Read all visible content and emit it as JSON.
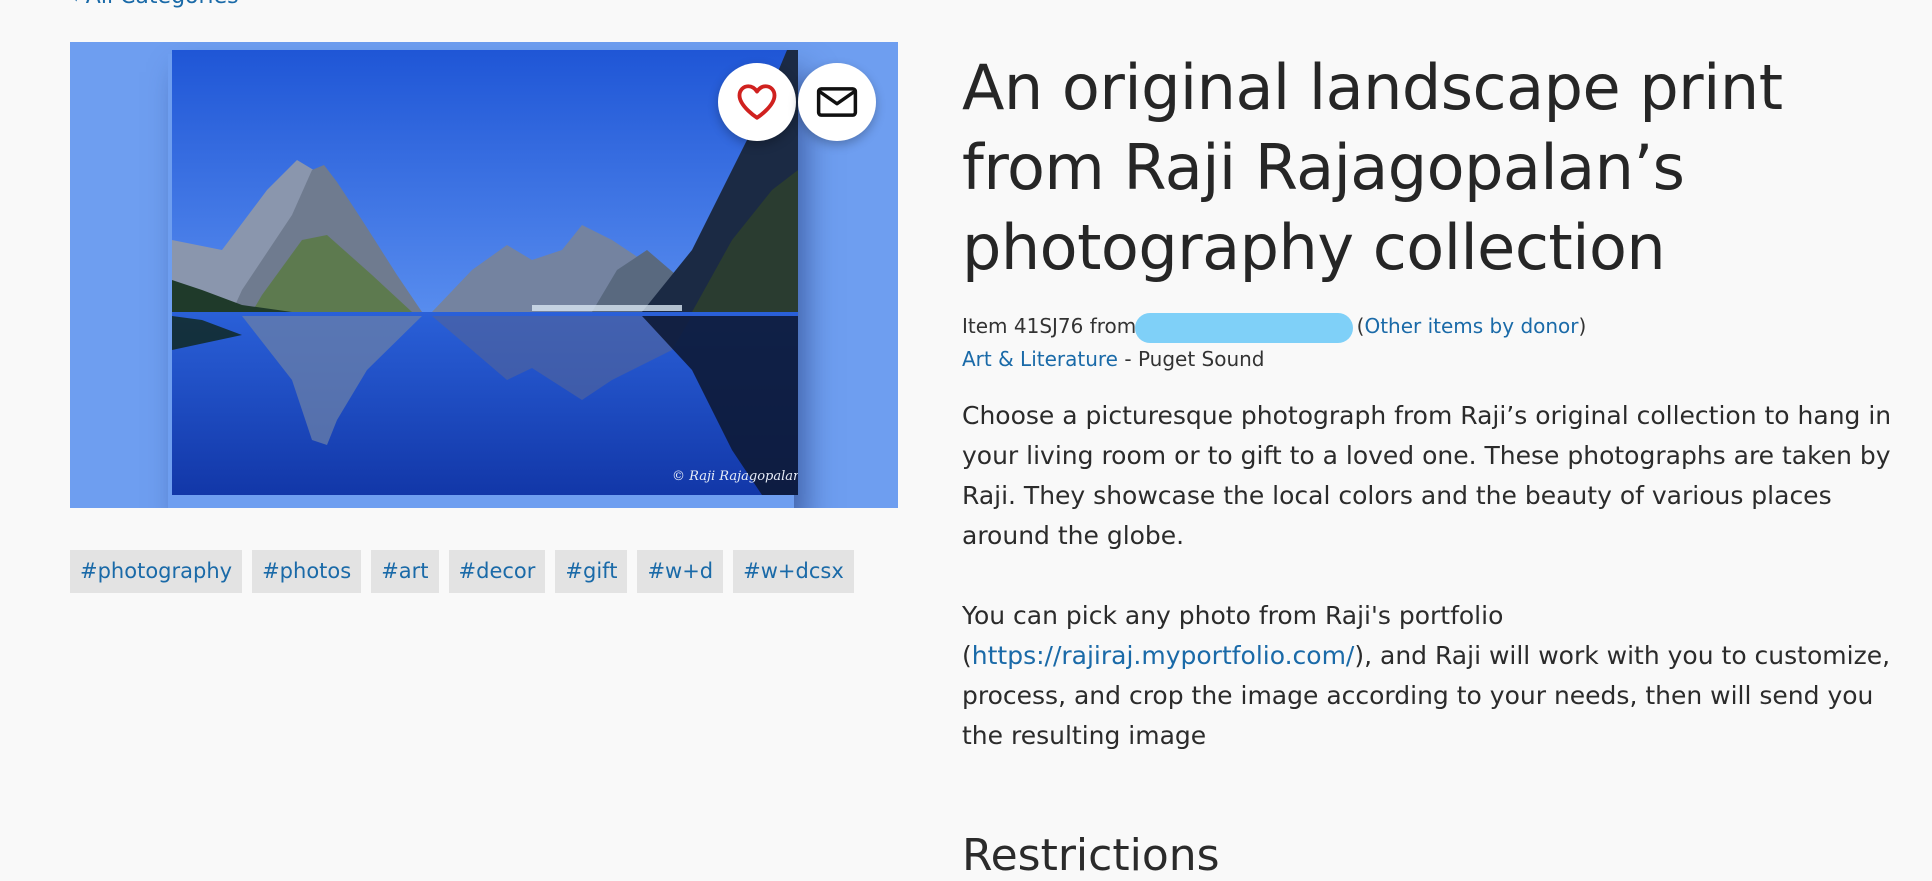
{
  "nav": {
    "back_label": "‹ All Categories"
  },
  "item": {
    "title": "An original landscape print from Raji Rajagopalan’s photography collection",
    "item_prefix": "Item 41SJ76 from",
    "other_items_label": "Other items by donor",
    "category_label": "Art & Literature",
    "category_separator": " - ",
    "location": "Puget Sound",
    "description_1": "Choose a picturesque photograph from Raji’s original collection to hang in your living room or to gift to a loved one. These photographs are taken by Raji. They showcase the local colors and the beauty of various places around the globe.",
    "description_2_prefix": "You can pick any photo from Raji's portfolio (",
    "description_2_link": "https://rajiraj.myportfolio.com/",
    "description_2_suffix": "), and Raji will work with you to customize, process, and crop the image according to your needs, then will send you the resulting image"
  },
  "photo": {
    "watermark": "© Raji Rajagopalan"
  },
  "actions": {
    "favorite_icon": "heart-icon",
    "mail_icon": "mail-icon"
  },
  "tags": [
    "#photography",
    "#photos",
    "#art",
    "#decor",
    "#gift",
    "#w+d",
    "#w+dcsx"
  ],
  "sections": {
    "restrictions_heading": "Restrictions"
  },
  "colors": {
    "link": "#1a6aa8",
    "tag_bg": "#e3e3e3",
    "photo_bg": "#6e9ef0",
    "heart": "#d0211f",
    "redaction": "#7fd0f8"
  }
}
